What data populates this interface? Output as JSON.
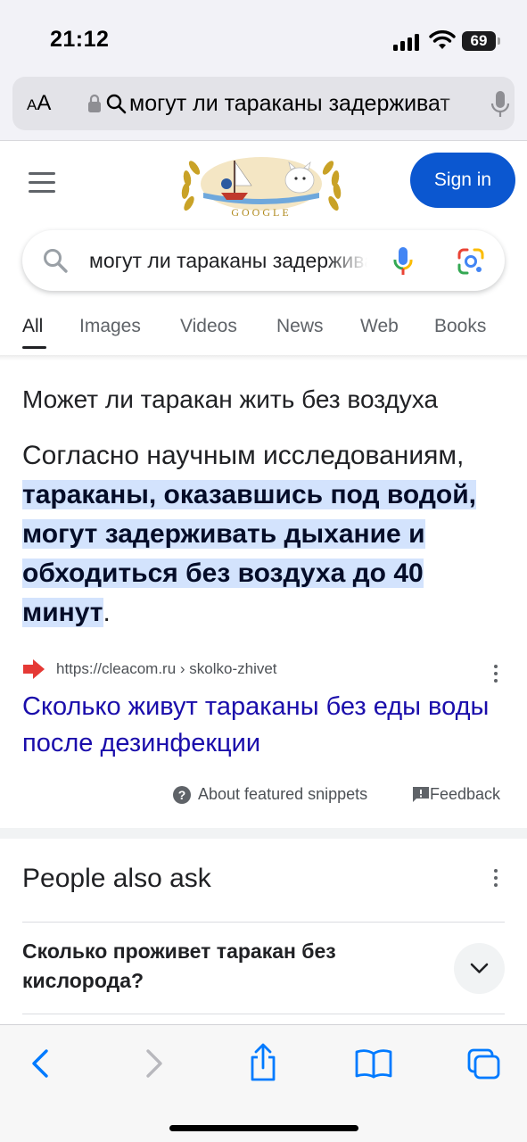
{
  "status_bar": {
    "time": "21:12",
    "battery": "69"
  },
  "address_bar": {
    "text_size_label": "AA",
    "url_text": "могут ли тараканы задерживат"
  },
  "header": {
    "doodle_text": "GOOGLE",
    "sign_in_label": "Sign in"
  },
  "search": {
    "query": "могут ли тараканы задерживать"
  },
  "tabs": [
    {
      "label": "All",
      "active": true
    },
    {
      "label": "Images",
      "active": false
    },
    {
      "label": "Videos",
      "active": false
    },
    {
      "label": "News",
      "active": false
    },
    {
      "label": "Web",
      "active": false
    },
    {
      "label": "Books",
      "active": false
    }
  ],
  "featured_snippet": {
    "title": "Может ли таракан жить без воздуха",
    "text_before": "Согласно научным исследованиям, ",
    "highlighted_text": "тараканы, оказавшись под водой, могут задерживать дыхание и обходиться без воздуха до 40 минут",
    "text_after": ".",
    "source_url": "https://cleacom.ru › skolko-zhivet",
    "source_title": "Сколько живут тараканы без еды воды после дезинфекции",
    "about_label": "About featured snippets",
    "feedback_label": "Feedback"
  },
  "people_also_ask": {
    "title": "People also ask",
    "questions": [
      "Сколько проживет таракан без кислорода?"
    ]
  },
  "colors": {
    "link": "#1a0dab",
    "highlight": "#d3e3fd",
    "sign_in": "#0b57d0",
    "ios_blue": "#007aff"
  },
  "icons": {
    "address_bar": [
      "lock-icon",
      "search-icon",
      "microphone-icon"
    ],
    "toolbar": [
      "back-icon",
      "forward-icon",
      "share-icon",
      "bookmarks-icon",
      "tabs-icon"
    ]
  }
}
